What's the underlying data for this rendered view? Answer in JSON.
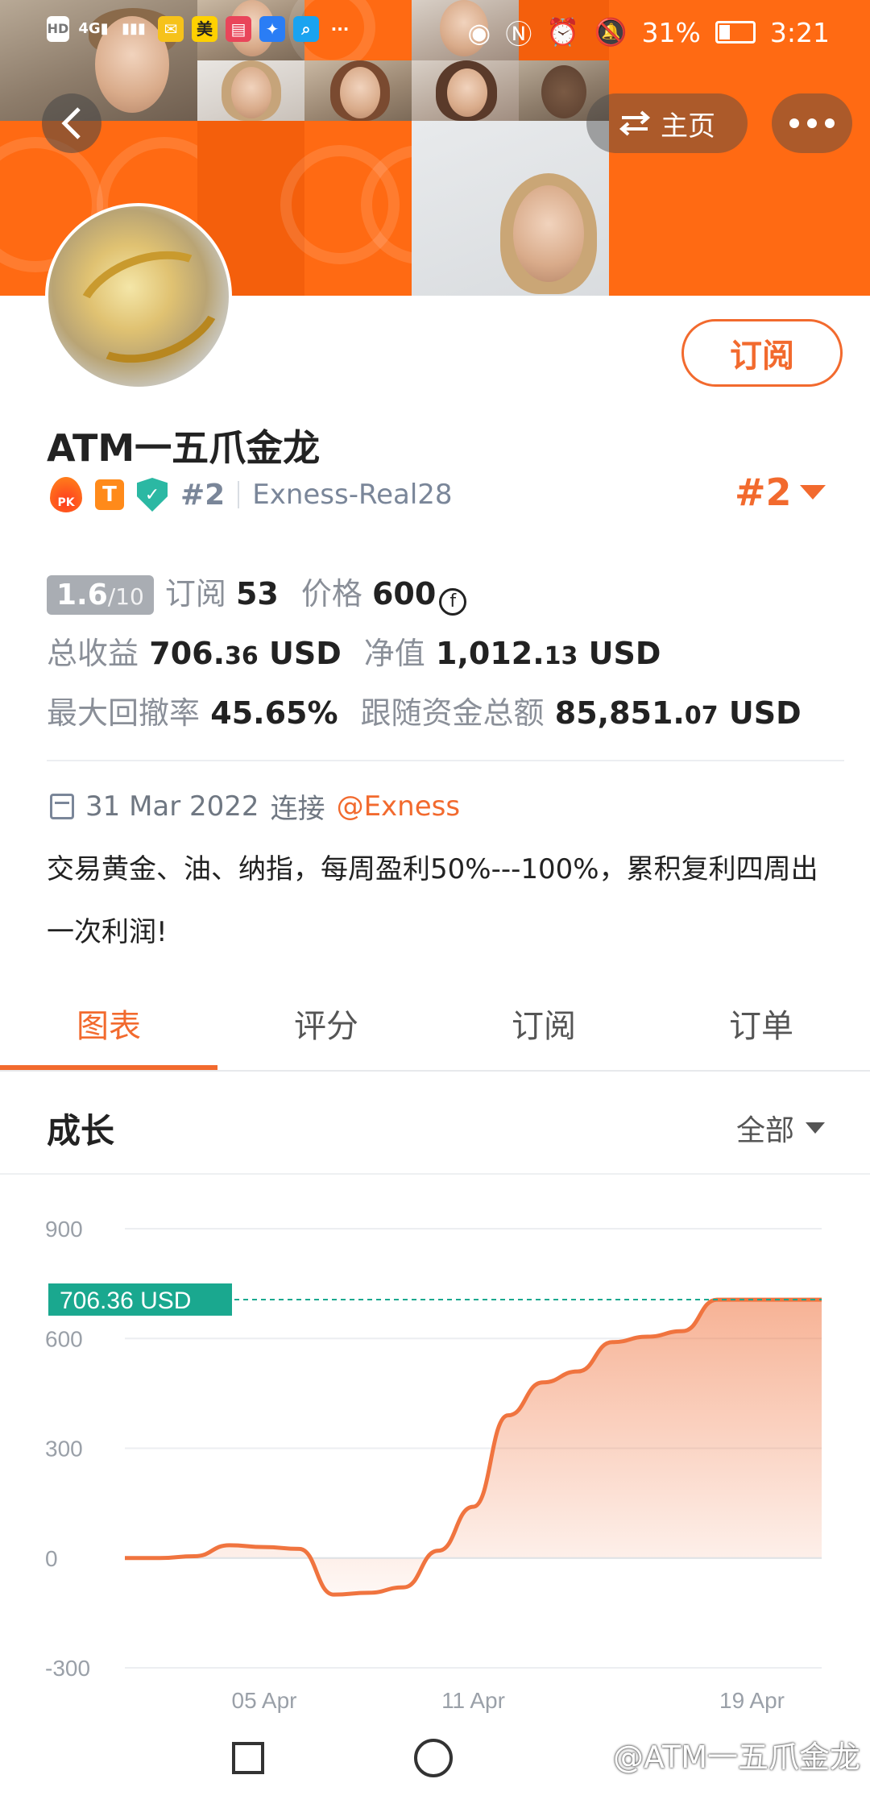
{
  "status_bar": {
    "left_icons": [
      "hd-icon",
      "signal-4g-icon",
      "signal-icon",
      "mail-app-icon",
      "meituan-app-icon",
      "book-app-icon",
      "bulb-app-icon",
      "search-app-icon",
      "more-icon"
    ],
    "meituan_label": "美",
    "battery_percent": "31%",
    "time": "3:21"
  },
  "header": {
    "home_label": "主页",
    "subscribe_label": "订阅"
  },
  "profile": {
    "name": "ATM一五爪金龙",
    "pk_badge": "PK",
    "t_badge": "T",
    "rank_small": "#2",
    "server": "Exness-Real28",
    "rank_big": "#2"
  },
  "stats": {
    "score": "1.6",
    "score_denominator": "/10",
    "subscribe_label": "订阅",
    "subscribe_count": "53",
    "price_label": "价格",
    "price_value": "600",
    "total_profit_label": "总收益",
    "total_profit_int": "706.",
    "total_profit_dec": "36",
    "total_profit_unit": "USD",
    "equity_label": "净值",
    "equity_int": "1,012.",
    "equity_dec": "13",
    "equity_unit": "USD",
    "max_drawdown_label": "最大回撤率",
    "max_drawdown_value": "45.65%",
    "follow_total_label": "跟随资金总额",
    "follow_total_int": "85,851.",
    "follow_total_dec": "07",
    "follow_total_unit": "USD"
  },
  "connection": {
    "date": "31 Mar 2022",
    "connect_label": "连接",
    "broker": "@Exness"
  },
  "description_line1": "交易黄金、油、纳指，每周盈利50%---100%，累积复利四周出",
  "description_line2": "一次利润!",
  "tabs": [
    "图表",
    "评分",
    "订阅",
    "订单"
  ],
  "active_tab": 0,
  "section": {
    "title": "成长",
    "filter_label": "全部"
  },
  "watermark": "@ATM一五爪金龙",
  "colors": {
    "accent": "#f26a2e",
    "teal": "#1aa88f",
    "chart_line": "#f0743f"
  },
  "chart_data": {
    "type": "area",
    "title": "成长",
    "xlabel": "",
    "ylabel": "",
    "ylim": [
      -300,
      900
    ],
    "yticks": [
      900,
      600,
      300,
      0,
      -300
    ],
    "xticks": [
      "05 Apr",
      "11 Apr",
      "19 Apr"
    ],
    "current_value_label": "706.36 USD",
    "current_value": 706.36,
    "grid": true,
    "series": [
      {
        "x": [
          "01 Apr",
          "02 Apr",
          "03 Apr",
          "04 Apr",
          "05 Apr",
          "06 Apr",
          "07 Apr",
          "08 Apr",
          "09 Apr",
          "10 Apr",
          "11 Apr",
          "12 Apr",
          "13 Apr",
          "14 Apr",
          "15 Apr",
          "16 Apr",
          "17 Apr",
          "18 Apr",
          "19 Apr",
          "20 Apr",
          "21 Apr"
        ],
        "values": [
          0,
          0,
          5,
          35,
          30,
          25,
          -100,
          -95,
          -80,
          20,
          140,
          390,
          480,
          510,
          590,
          605,
          620,
          706,
          706,
          706,
          706
        ]
      }
    ]
  }
}
